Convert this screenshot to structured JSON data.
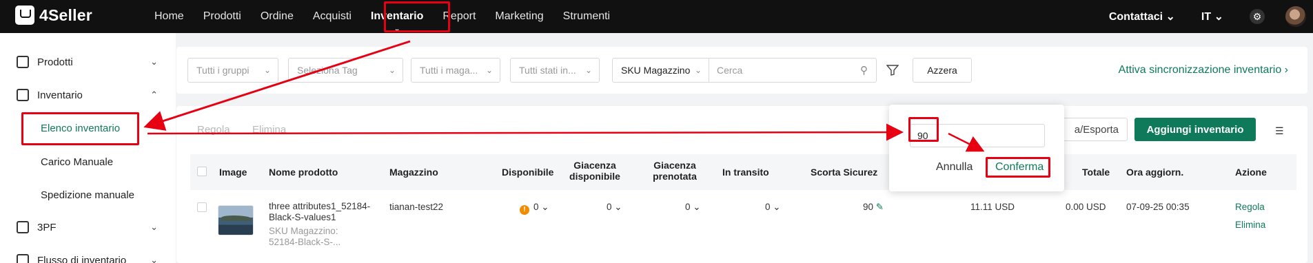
{
  "app": {
    "logo_text": "4Seller"
  },
  "nav": {
    "items": [
      "Home",
      "Prodotti",
      "Ordine",
      "Acquisti",
      "Inventario",
      "Report",
      "Marketing",
      "Strumenti"
    ],
    "active": "Inventario",
    "contact": "Contattaci",
    "language": "IT"
  },
  "sidebar": {
    "groups": [
      {
        "label": "Prodotti",
        "icon": "product-icon",
        "expanded": false
      },
      {
        "label": "Inventario",
        "icon": "inventory-icon",
        "expanded": true
      },
      {
        "label": "3PF",
        "icon": "3pf-icon",
        "expanded": false
      },
      {
        "label": "Flusso di inventario",
        "icon": "flow-icon",
        "expanded": false
      }
    ],
    "sub_items": [
      "Elenco inventario",
      "Carico Manuale",
      "Spedizione manuale"
    ],
    "active_sub": "Elenco inventario"
  },
  "filters": {
    "groups": "Tutti i gruppi",
    "tag": "Seleziona Tag",
    "warehouse": "Tutti i maga...",
    "status": "Tutti stati in...",
    "search_field": "SKU Magazzino",
    "search_placeholder": "Cerca",
    "reset": "Azzera",
    "sync_link": "Attiva sincronizzazione inventario"
  },
  "toolbar": {
    "adjust": "Regola",
    "delete": "Elimina",
    "export": "a/Esporta",
    "add": "Aggiungi inventario"
  },
  "table": {
    "headers": {
      "image": "Image",
      "name": "Nome prodotto",
      "warehouse": "Magazzino",
      "available": "Disponibile",
      "stock_available": "Giacenza disponibile",
      "stock_reserved": "Giacenza prenotata",
      "in_transit": "In transito",
      "safety": "Scorta Sicurez",
      "total": "Totale",
      "updated": "Ora aggiorn.",
      "action": "Azione"
    },
    "rows": [
      {
        "name": "three attributes1_52184-Black-S-values1",
        "sku_label": "SKU Magazzino:",
        "sku": "52184-Black-S-...",
        "warehouse": "tianan-test22",
        "available": "0",
        "stock_available": "0",
        "stock_reserved": "0",
        "in_transit": "0",
        "safety": "90",
        "cost": "11.11",
        "cost_currency": "USD",
        "total": "0.00",
        "total_currency": "USD",
        "updated": "07-09-25 00:35",
        "action_adjust": "Regola",
        "action_delete": "Elimina"
      }
    ]
  },
  "popover": {
    "value": "90",
    "cancel": "Annulla",
    "confirm": "Conferma"
  },
  "colors": {
    "accent": "#0e7a5a",
    "annotation": "#e60012",
    "topbar": "#111111"
  }
}
